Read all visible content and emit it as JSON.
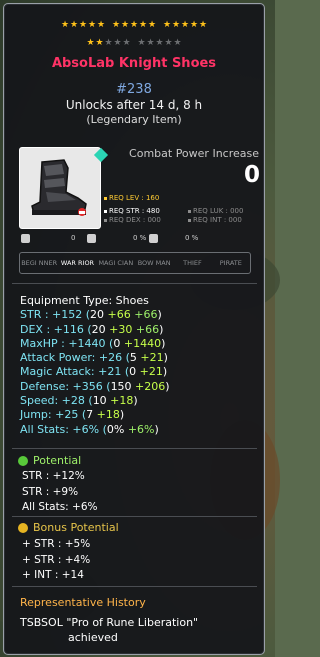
{
  "stars": {
    "top_row": [
      "gold",
      "gold",
      "gold",
      "gold",
      "gold",
      "gold",
      "gold",
      "gold",
      "gold",
      "gold",
      "gold",
      "gold",
      "gold",
      "gold",
      "gold"
    ],
    "second_row": [
      "gold",
      "gold",
      "grey",
      "grey",
      "grey",
      "grey",
      "grey",
      "grey",
      "grey",
      "grey"
    ],
    "filled": 17,
    "total": 25
  },
  "item": {
    "name": "AbsoLab Knight Shoes",
    "potential_number": "#238",
    "unlock_text": "Unlocks after 14 d, 8 h",
    "rarity_text": "(Legendary Item)"
  },
  "combat_power": {
    "label": "Combat Power Increase",
    "value": "0"
  },
  "requirements": {
    "lev": "REQ LEV : 160",
    "str": "REQ STR : 480",
    "dex": "REQ DEX : 000",
    "luk": "REQ LUK : 000",
    "int": "REQ INT : 000"
  },
  "mini": {
    "v1": "0",
    "v2": "0 %",
    "v3": "0 %"
  },
  "jobs": [
    {
      "label": "BEGI NNER",
      "active": false
    },
    {
      "label": "WAR RIOR",
      "active": true
    },
    {
      "label": "MAGI CIAN",
      "active": false
    },
    {
      "label": "BOW MAN",
      "active": false
    },
    {
      "label": "THIEF",
      "active": false
    },
    {
      "label": "PIRATE",
      "active": false
    }
  ],
  "stats": {
    "equipment_type": "Equipment Type: Shoes",
    "lines": [
      {
        "label": "STR : +152 (",
        "base": "20",
        "p1": " +66",
        "p2": " +66",
        "end": ")"
      },
      {
        "label": "DEX : +116 (",
        "base": "20",
        "p1": " +30",
        "p2": " +66",
        "end": ")"
      },
      {
        "label": "MaxHP : +1440 (",
        "base": "0",
        "p1": " +1440",
        "p2": "",
        "end": ")"
      },
      {
        "label": "Attack Power: +26 (",
        "base": "5",
        "p1": " +21",
        "p2": "",
        "end": ")"
      },
      {
        "label": "Magic Attack: +21 (",
        "base": "0",
        "p1": " +21",
        "p2": "",
        "end": ")"
      },
      {
        "label": "Defense: +356 (",
        "base": "150",
        "p1": " +206",
        "p2": "",
        "end": ")"
      },
      {
        "label": "Speed: +28 (",
        "base": "10",
        "p1": " +18",
        "p2": "",
        "end": ")"
      },
      {
        "label": "Jump: +25 (",
        "base": "7",
        "p1": " +18",
        "p2": "",
        "end": ")"
      },
      {
        "label": "All Stats: +6% (",
        "base": "0%",
        "p1": "",
        "p2": " +6%",
        "end": ")"
      }
    ]
  },
  "potential": {
    "title": "Potential",
    "lines": [
      "STR : +12%",
      "STR : +9%",
      "All Stats: +6%"
    ]
  },
  "bonus_potential": {
    "title": "Bonus Potential",
    "lines": [
      "+ STR : +5%",
      "+ STR : +4%",
      "+ INT : +14"
    ]
  },
  "history": {
    "title": "Representative History",
    "line1": "TSBSOL \"Pro of Rune Liberation\"",
    "line2": "achieved"
  },
  "colors": {
    "name": "#ff3366",
    "potential_number": "#7fa8e0",
    "potential_badge": "#58c93a",
    "bonus_badge": "#e6b422",
    "history_title": "#ffb44a"
  }
}
